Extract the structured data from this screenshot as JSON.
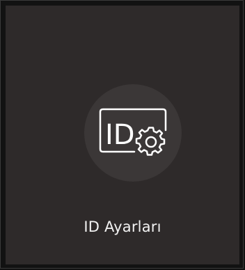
{
  "menu_tile": {
    "label": "ID Ayarları",
    "icon": "id-settings-icon",
    "icon_text": "ID"
  }
}
